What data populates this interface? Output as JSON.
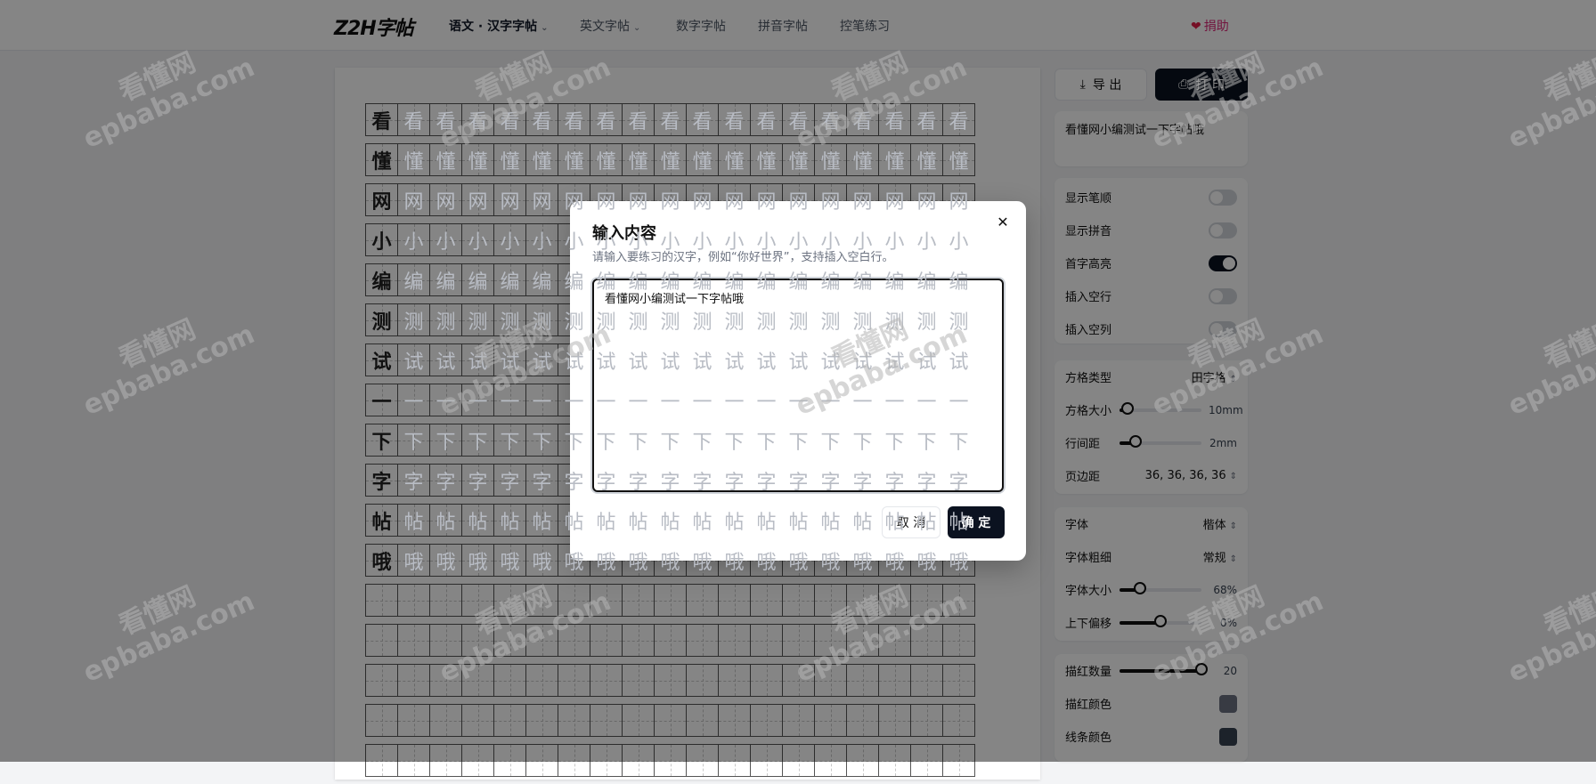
{
  "header": {
    "logo": "Z2H字帖",
    "nav": [
      {
        "label": "语文 · 汉字字帖",
        "active": true,
        "dropdown": true
      },
      {
        "label": "英文字帖",
        "active": false,
        "dropdown": true
      },
      {
        "label": "数字字帖",
        "active": false,
        "dropdown": false
      },
      {
        "label": "拼音字帖",
        "active": false,
        "dropdown": false
      },
      {
        "label": "控笔练习",
        "active": false,
        "dropdown": false
      }
    ],
    "donate": "捐助"
  },
  "paper": {
    "characters": [
      "看",
      "懂",
      "网",
      "小",
      "编",
      "测",
      "试",
      "一",
      "下",
      "字",
      "帖",
      "哦"
    ],
    "columns": 19,
    "empty_rows": 5
  },
  "sidebar": {
    "export_label": "导 出",
    "print_label": "打 印",
    "preview_text": "看懂网小编测试一下字帖哦",
    "toggles": [
      {
        "label": "显示笔顺",
        "on": false
      },
      {
        "label": "显示拼音",
        "on": false
      },
      {
        "label": "首字高亮",
        "on": true
      },
      {
        "label": "插入空行",
        "on": false
      },
      {
        "label": "插入空列",
        "on": false
      }
    ],
    "grid_settings": {
      "grid_type_label": "方格类型",
      "grid_type_value": "田字格",
      "grid_size_label": "方格大小",
      "grid_size_value": "10mm",
      "grid_size_level": 0.1,
      "line_spacing_label": "行间距",
      "line_spacing_value": "2mm",
      "line_spacing_level": 0.2,
      "margin_label": "页边距",
      "margin_value": "36, 36, 36, 36"
    },
    "font_settings": {
      "font_label": "字体",
      "font_value": "楷体",
      "weight_label": "字体粗细",
      "weight_value": "常规",
      "size_label": "字体大小",
      "size_value": "68%",
      "size_level": 0.25,
      "offset_label": "上下偏移",
      "offset_value": "0%",
      "offset_level": 0.5
    },
    "trace_settings": {
      "count_label": "描红数量",
      "count_value": "20",
      "count_level": 1.0,
      "trace_color_label": "描红颜色",
      "trace_color": "#6b7280",
      "line_color_label": "线条颜色",
      "line_color": "#374151"
    }
  },
  "watermark": {
    "cn": "看懂网",
    "url": "epbaba.com"
  },
  "modal": {
    "title": "输入内容",
    "description": "请输入要练习的汉字，例如“你好世界”，支持插入空白行。",
    "textarea_value": "看懂网小编测试一下字帖哦",
    "cancel_label": "取 消",
    "ok_label": "确 定"
  }
}
